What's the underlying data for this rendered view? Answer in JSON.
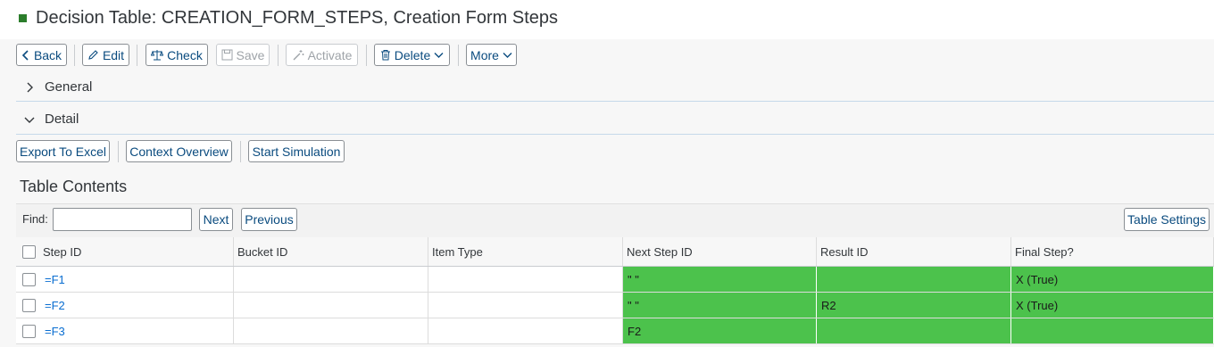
{
  "header": {
    "title": "Decision Table: CREATION_FORM_STEPS, Creation Form Steps",
    "marker_color": "#2b7d2b"
  },
  "toolbar": {
    "back": "Back",
    "edit": "Edit",
    "check": "Check",
    "save": "Save",
    "activate": "Activate",
    "delete": "Delete",
    "more": "More"
  },
  "sections": {
    "general": "General",
    "detail": "Detail"
  },
  "detail_toolbar": {
    "export": "Export To Excel",
    "context": "Context Overview",
    "simulation": "Start Simulation"
  },
  "table": {
    "title": "Table Contents",
    "find_label": "Find:",
    "find_value": "",
    "next": "Next",
    "previous": "Previous",
    "settings": "Table Settings",
    "columns": [
      "Step ID",
      "Bucket ID",
      "Item Type",
      "Next Step ID",
      "Result ID",
      "Final Step?"
    ],
    "rows": [
      [
        "=F1",
        "",
        "",
        "\" \"",
        "",
        "X (True)"
      ],
      [
        "=F2",
        "",
        "",
        "\" \"",
        "R2",
        "X (True)"
      ],
      [
        "=F3",
        "",
        "",
        "F2",
        "",
        ""
      ]
    ],
    "highlight_color": "#4cc24c"
  }
}
